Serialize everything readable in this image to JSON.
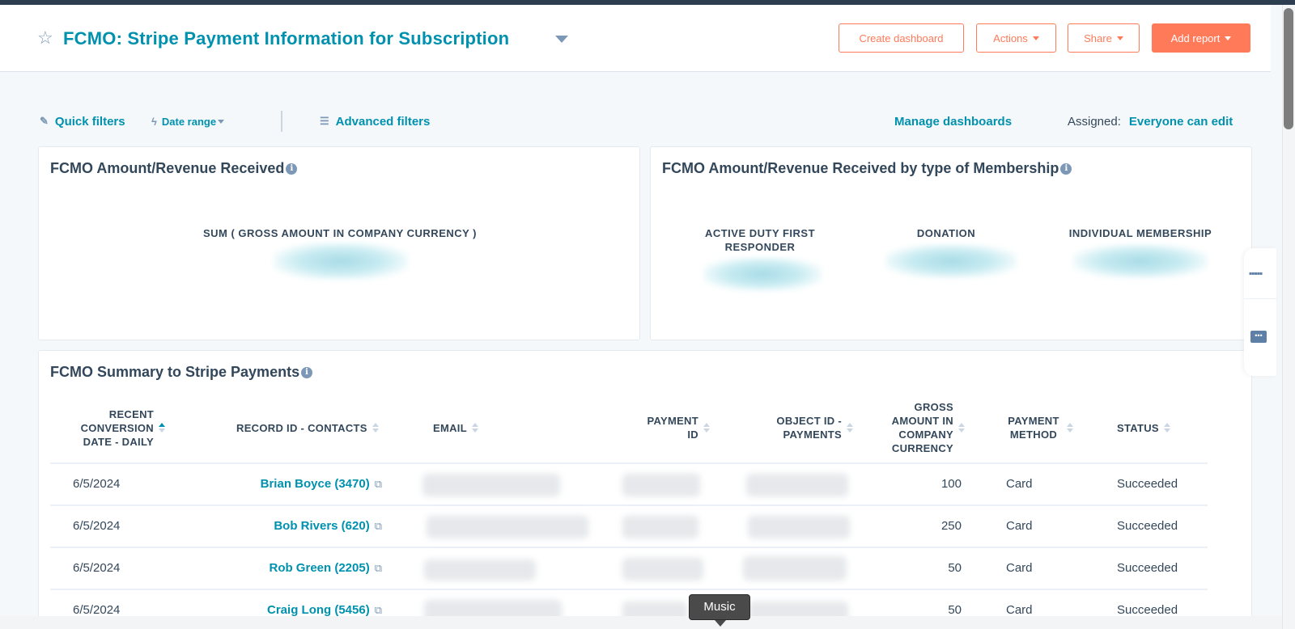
{
  "header": {
    "title": "FCMO: Stripe Payment Information for Subscription",
    "buttons": {
      "create_dashboard": "Create dashboard",
      "actions": "Actions",
      "share": "Share",
      "add_report": "Add report"
    }
  },
  "filters": {
    "quick_filters": "Quick filters",
    "date_range": "Date range",
    "advanced_filters": "Advanced filters",
    "manage_dashboards": "Manage dashboards",
    "assigned_label": "Assigned:",
    "assigned_value": "Everyone can edit"
  },
  "cards": {
    "revenue": {
      "title": "FCMO Amount/Revenue Received",
      "metric_label": "SUM ( GROSS AMOUNT IN COMPANY CURRENCY )"
    },
    "membership": {
      "title": "FCMO Amount/Revenue Received by type of Membership",
      "metrics": [
        {
          "label": "ACTIVE DUTY FIRST RESPONDER"
        },
        {
          "label": "DONATION"
        },
        {
          "label": "INDIVIDUAL MEMBERSHIP"
        }
      ]
    }
  },
  "table": {
    "title": "FCMO Summary to Stripe Payments",
    "columns": [
      {
        "label": "RECENT CONVERSION DATE - DAILY",
        "sorted": "asc"
      },
      {
        "label": "RECORD ID - CONTACTS"
      },
      {
        "label": "EMAIL"
      },
      {
        "label": "PAYMENT ID"
      },
      {
        "label": "OBJECT ID - PAYMENTS"
      },
      {
        "label": "GROSS AMOUNT IN COMPANY CURRENCY"
      },
      {
        "label": "PAYMENT METHOD"
      },
      {
        "label": "STATUS"
      }
    ],
    "rows": [
      {
        "date": "6/5/2024",
        "contact": "Brian Boyce (3470)",
        "amount": "100",
        "method": "Card",
        "status": "Succeeded"
      },
      {
        "date": "6/5/2024",
        "contact": "Bob Rivers (620)",
        "amount": "250",
        "method": "Card",
        "status": "Succeeded"
      },
      {
        "date": "6/5/2024",
        "contact": "Rob Green (2205)",
        "amount": "50",
        "method": "Card",
        "status": "Succeeded"
      },
      {
        "date": "6/5/2024",
        "contact": "Craig Long (5456)",
        "amount": "50",
        "method": "Card",
        "status": "Succeeded"
      }
    ]
  },
  "tooltip": "Music",
  "colors": {
    "brand_link": "#0091ae",
    "accent_orange": "#ff7a59",
    "text": "#33475b"
  }
}
